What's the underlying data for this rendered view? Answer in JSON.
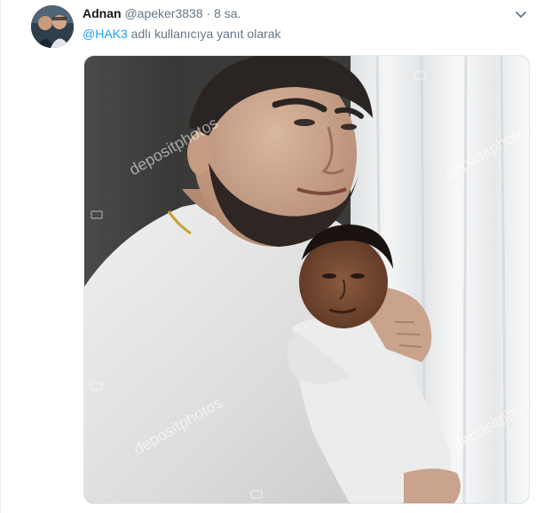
{
  "tweet": {
    "display_name": "Adnan",
    "handle": "@apeker3838",
    "separator": "·",
    "time": "8 sa.",
    "reply_mention": "@HAK3",
    "reply_suffix": " adlı kullanıcıya yanıt olarak"
  },
  "media": {
    "watermark": "depositphotos"
  },
  "colors": {
    "link": "#1da1f2",
    "secondary_text": "#657786",
    "primary_text": "#14171a"
  },
  "icons": {
    "menu": "chevron-down-icon"
  }
}
